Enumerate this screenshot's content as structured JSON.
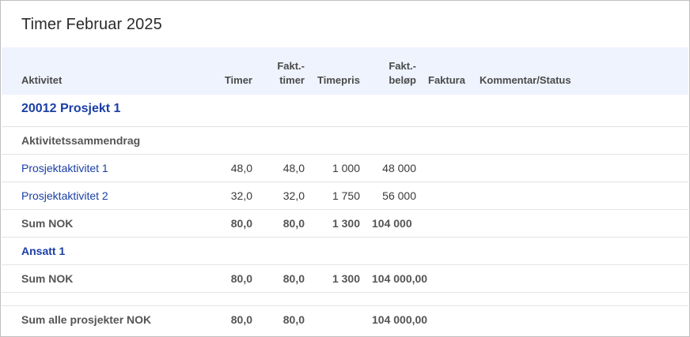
{
  "title": "Timer Februar 2025",
  "columns": {
    "aktivitet": "Aktivitet",
    "timer": "Timer",
    "fakt_timer_l1": "Fakt.-",
    "fakt_timer_l2": "timer",
    "timepris": "Timepris",
    "fakt_belop_l1": "Fakt.-",
    "fakt_belop_l2": "beløp",
    "faktura": "Faktura",
    "kommentar": "Kommentar/Status"
  },
  "project": "20012 Prosjekt 1",
  "section": "Aktivitetssammendrag",
  "activities": [
    {
      "name": "Prosjektaktivitet 1",
      "timer": "48,0",
      "fakt_timer": "48,0",
      "timepris": "1 000",
      "fakt_belop": "48 000"
    },
    {
      "name": "Prosjektaktivitet 2",
      "timer": "32,0",
      "fakt_timer": "32,0",
      "timepris": "1 750",
      "fakt_belop": "56 000"
    }
  ],
  "sum_activities": {
    "label": "Sum NOK",
    "timer": "80,0",
    "fakt_timer": "80,0",
    "timepris": "1 300",
    "fakt_belop": "104 000"
  },
  "employee": "Ansatt 1",
  "sum_employee": {
    "label": "Sum NOK",
    "timer": "80,0",
    "fakt_timer": "80,0",
    "timepris": "1 300",
    "fakt_belop": "104 000,00"
  },
  "sum_all": {
    "label": "Sum alle prosjekter NOK",
    "timer": "80,0",
    "fakt_timer": "80,0",
    "fakt_belop": "104 000,00"
  }
}
